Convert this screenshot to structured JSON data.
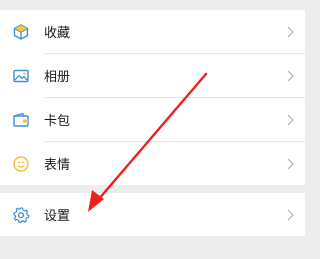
{
  "menu": {
    "items": [
      {
        "label": "收藏",
        "icon": "cube-icon"
      },
      {
        "label": "相册",
        "icon": "photo-icon"
      },
      {
        "label": "卡包",
        "icon": "wallet-icon"
      },
      {
        "label": "表情",
        "icon": "emoji-icon"
      }
    ],
    "settings": {
      "label": "设置",
      "icon": "gear-icon"
    }
  },
  "colors": {
    "accent_arrow": "#e8231f",
    "icon_blue": "#3f8fd8",
    "icon_yellow": "#f5c035",
    "background": "#ededed"
  }
}
